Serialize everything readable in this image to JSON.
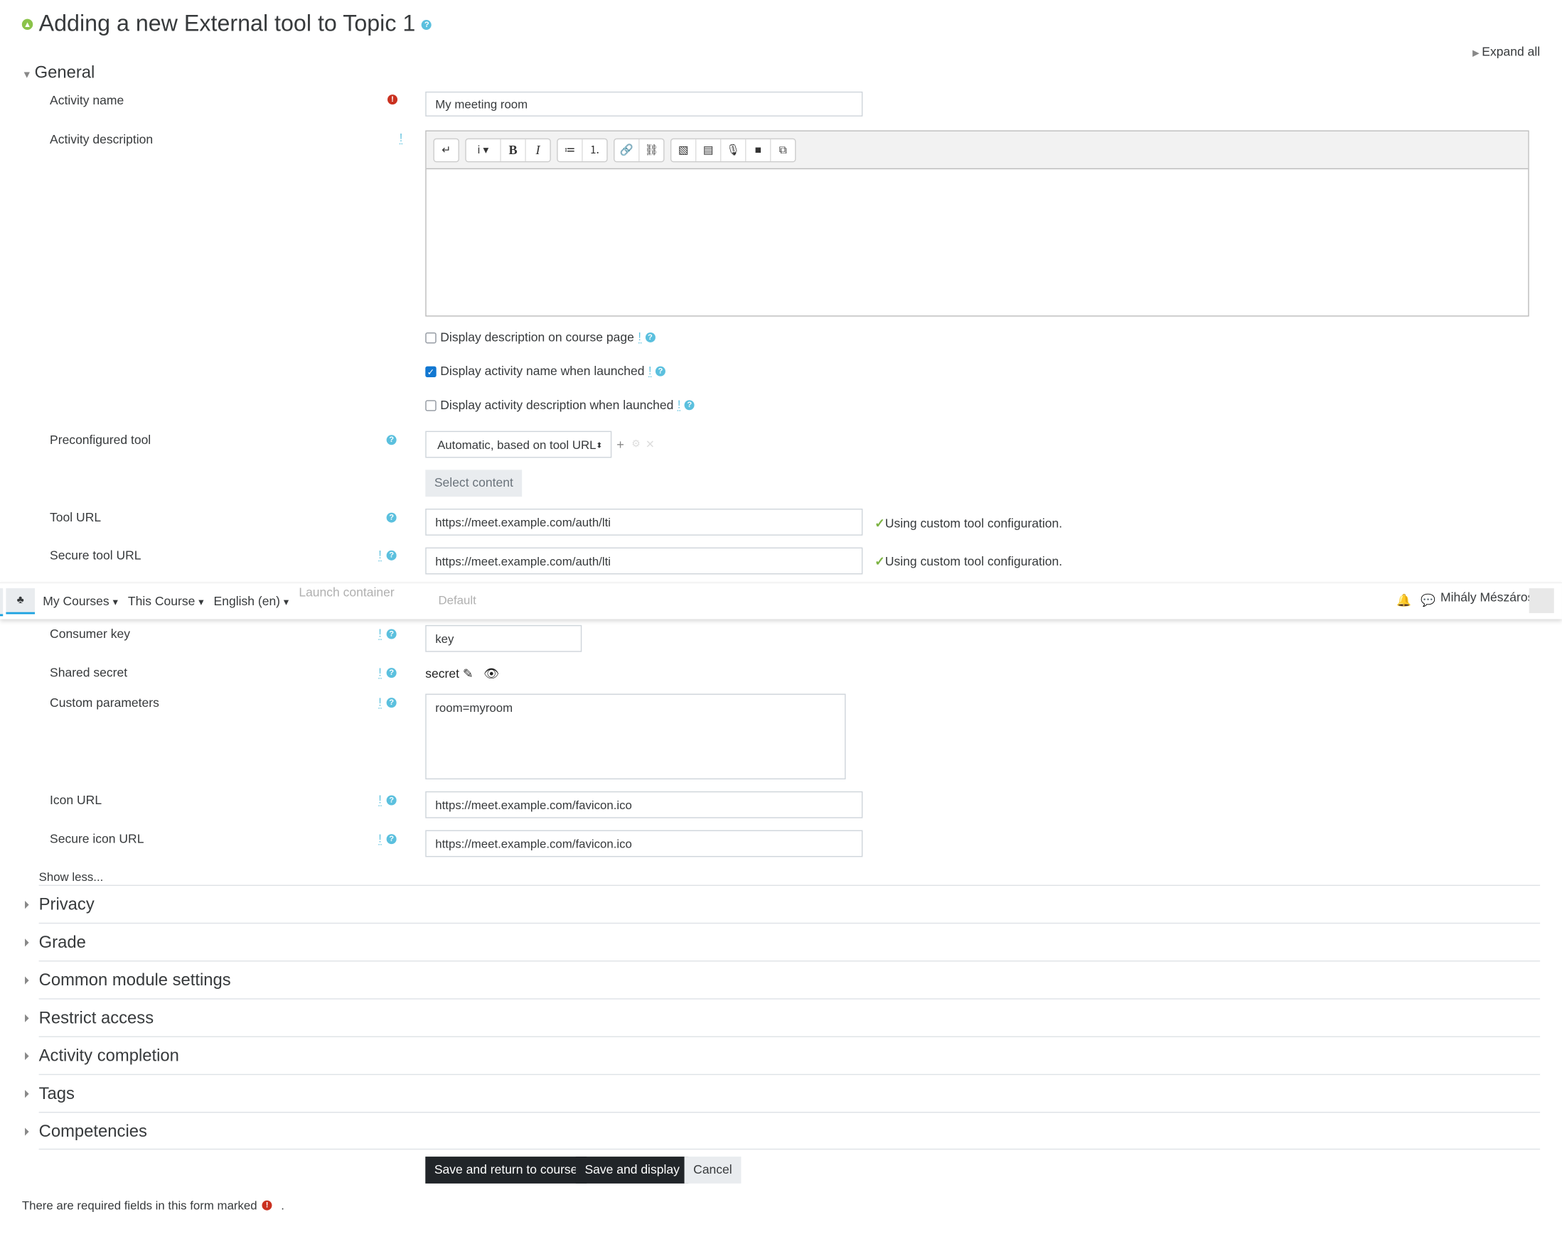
{
  "page": {
    "title": "Adding a new External tool to Topic 1",
    "expand_all": "Expand all"
  },
  "general": {
    "heading": "General",
    "activity_name": {
      "label": "Activity name",
      "value": "My meeting room"
    },
    "activity_description": {
      "label": "Activity description",
      "toolbar": [
        "↵",
        "i ▾",
        "B",
        "I",
        "≔",
        "⒈",
        "🔗",
        "⛓",
        "▧",
        "▤",
        "🎙",
        "■",
        "⧉"
      ]
    },
    "checkboxes": [
      {
        "label": "Display description on course page",
        "checked": false
      },
      {
        "label": "Display activity name when launched",
        "checked": true
      },
      {
        "label": "Display activity description when launched",
        "checked": false
      }
    ],
    "preconfigured_tool": {
      "label": "Preconfigured tool",
      "value": "Automatic, based on tool URL",
      "select_content": "Select content"
    },
    "tool_url": {
      "label": "Tool URL",
      "value": "https://meet.example.com/auth/lti",
      "status": "Using custom tool configuration."
    },
    "secure_tool_url": {
      "label": "Secure tool URL",
      "value": "https://meet.example.com/auth/lti",
      "status": "Using custom tool configuration."
    },
    "launch_container": {
      "label": "Launch container",
      "value": "Default"
    },
    "consumer_key": {
      "label": "Consumer key",
      "value": "key"
    },
    "shared_secret": {
      "label": "Shared secret",
      "value": "secret"
    },
    "custom_parameters": {
      "label": "Custom parameters",
      "value": "room=myroom"
    },
    "icon_url": {
      "label": "Icon URL",
      "value": "https://meet.example.com/favicon.ico"
    },
    "secure_icon_url": {
      "label": "Secure icon URL",
      "value": "https://meet.example.com/favicon.ico"
    },
    "show_less": "Show less..."
  },
  "sections": [
    "Privacy",
    "Grade",
    "Common module settings",
    "Restrict access",
    "Activity completion",
    "Tags",
    "Competencies"
  ],
  "buttons": {
    "save_return": "Save and return to course",
    "save_display": "Save and display",
    "cancel": "Cancel"
  },
  "footer": {
    "required_note": "There are required fields in this form marked",
    ".": "."
  },
  "navbar": {
    "items": [
      "My Courses",
      "This Course",
      "English (en)"
    ],
    "user": "Mihály Mészáros"
  },
  "colors": {
    "accent": "#5bc0de",
    "required": "#ca3120",
    "primary_button": "#212529",
    "success": "#7cb342"
  }
}
